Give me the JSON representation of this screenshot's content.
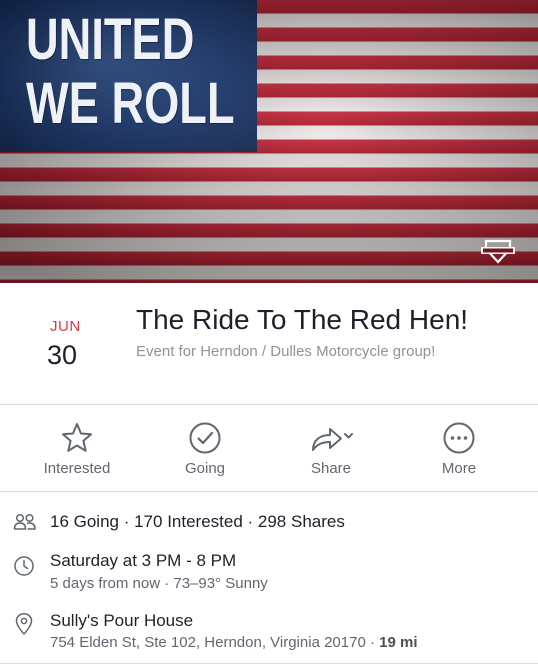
{
  "cover": {
    "slogan_line1": "UNITED",
    "slogan_line2": "WE ROLL",
    "logo": "bar-and-shield-logo"
  },
  "event": {
    "month": "JUN",
    "day": "30",
    "title": "The Ride To The Red Hen!",
    "subtitle": "Event for Herndon / Dulles Motorcycle group!"
  },
  "actions": [
    {
      "label": "Interested",
      "icon": "star-outline-icon"
    },
    {
      "label": "Going",
      "icon": "check-circle-icon"
    },
    {
      "label": "Share",
      "icon": "share-arrow-icon"
    },
    {
      "label": "More",
      "icon": "more-dots-icon"
    }
  ],
  "info": {
    "attendance": "16 Going · 170 Interested · 298 Shares",
    "time_main": "Saturday at 3 PM - 8 PM",
    "time_sub": "5 days from now · 73–93° Sunny",
    "place_name": "Sully's Pour House",
    "place_address": "754 Elden St, Ste 102, Herndon, Virginia 20170 · ",
    "place_distance": "19 mi"
  },
  "colors": {
    "month_red": "#e0393e",
    "flag_blue": "#1f3f7d",
    "flag_red": "#c2283a",
    "icon_gray": "#606770",
    "divider": "#dadde1"
  }
}
